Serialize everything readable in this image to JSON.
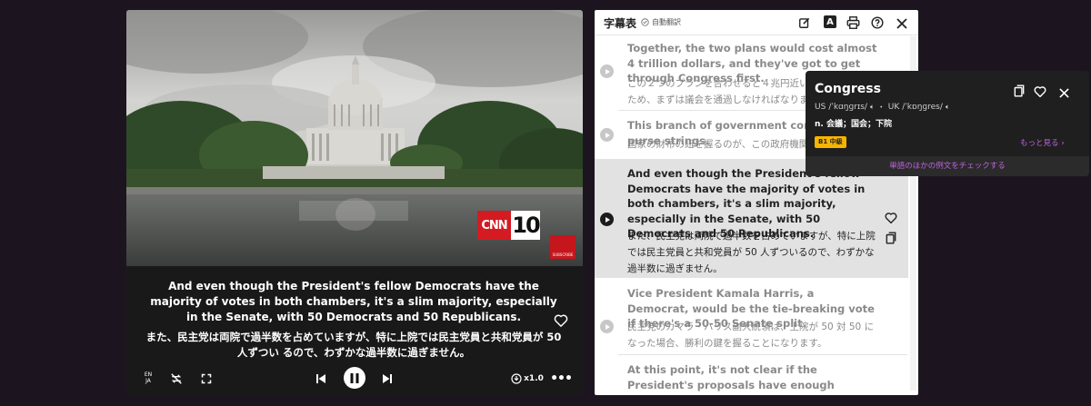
{
  "player": {
    "brand_logo": "CNN",
    "brand_number": "10",
    "subscribe_badge": "SUBSCRIBE",
    "caption_en": "And even though the President's fellow Democrats have the majority of votes in both chambers, it's a slim majority, especially in the Senate, with 50 Democrats and 50 Republicans.",
    "caption_ja": "また、民主党は両院で過半数を占めていますが、特に上院では民主党員と共和党員が 50 人ずつい るので、わずかな過半数に過ぎません。",
    "lang_toggle_label": "EN\nJA",
    "speed_label": "x1.0",
    "icons": [
      "favorite-icon",
      "lang-toggle-icon",
      "repeat-off-icon",
      "fullscreen-icon",
      "skip-previous-icon",
      "pause-icon",
      "skip-next-icon",
      "speed-icon",
      "more-icon"
    ]
  },
  "subtitles": {
    "title": "字幕表",
    "auto_translate": "自動翻訳",
    "icons": [
      "edit-icon",
      "font-icon",
      "print-icon",
      "help-icon",
      "close-icon"
    ],
    "items": [
      {
        "en": "Together, the two plans would cost almost 4 trillion dollars, and they've got to get through Congress first.",
        "ja": "この２つのプランを合わせると４兆円近い費用がかか るため、まずは議会を通過しなければなりません。",
        "active": false
      },
      {
        "en": "This branch of government controls the purse strings.",
        "ja": "国家の財布の紐を握るのが、この政府機関です。",
        "active": false
      },
      {
        "en": "And even though the President's fellow Democrats have the majority of votes in both chambers, it's a slim majority, especially in the Senate, with 50 Democrats and 50 Republicans.",
        "ja": "また、民主党は両院で過半数を占めていますが、特に上院では民主党員と共和党員が 50 人ずついるので、わずかな過半数に過ぎません。",
        "active": true
      },
      {
        "en": "Vice President Kamala Harris, a Democrat, would be the tie-breaking vote if there's a 50-50 Senate split.",
        "ja": "民主党のカマラ・ハリス副大統領は、上院が 50 対 50 になった場合、勝利の鍵を握ることになります。",
        "active": false
      },
      {
        "en": "At this point, it's not clear if the President's proposals have enough congressional support to pass, it's not",
        "ja": "",
        "active": false
      }
    ]
  },
  "popup": {
    "word": "Congress",
    "pron_us_label": "US",
    "pron_us": "/ˈkɑŋɡrɪs/",
    "pron_sep": "・",
    "pron_uk_label": "UK",
    "pron_uk": "/ˈkɒŋɡres/",
    "definition": "n. 会議；国会；下院",
    "level_badge": "B1 中級",
    "more_link": "もっと見る",
    "examples_link": "単語のほかの例文をチェックする",
    "icons": [
      "copy-icon",
      "favorite-icon",
      "close-icon"
    ],
    "colors": {
      "badge": "#f7b500",
      "link": "#c064e0"
    }
  }
}
